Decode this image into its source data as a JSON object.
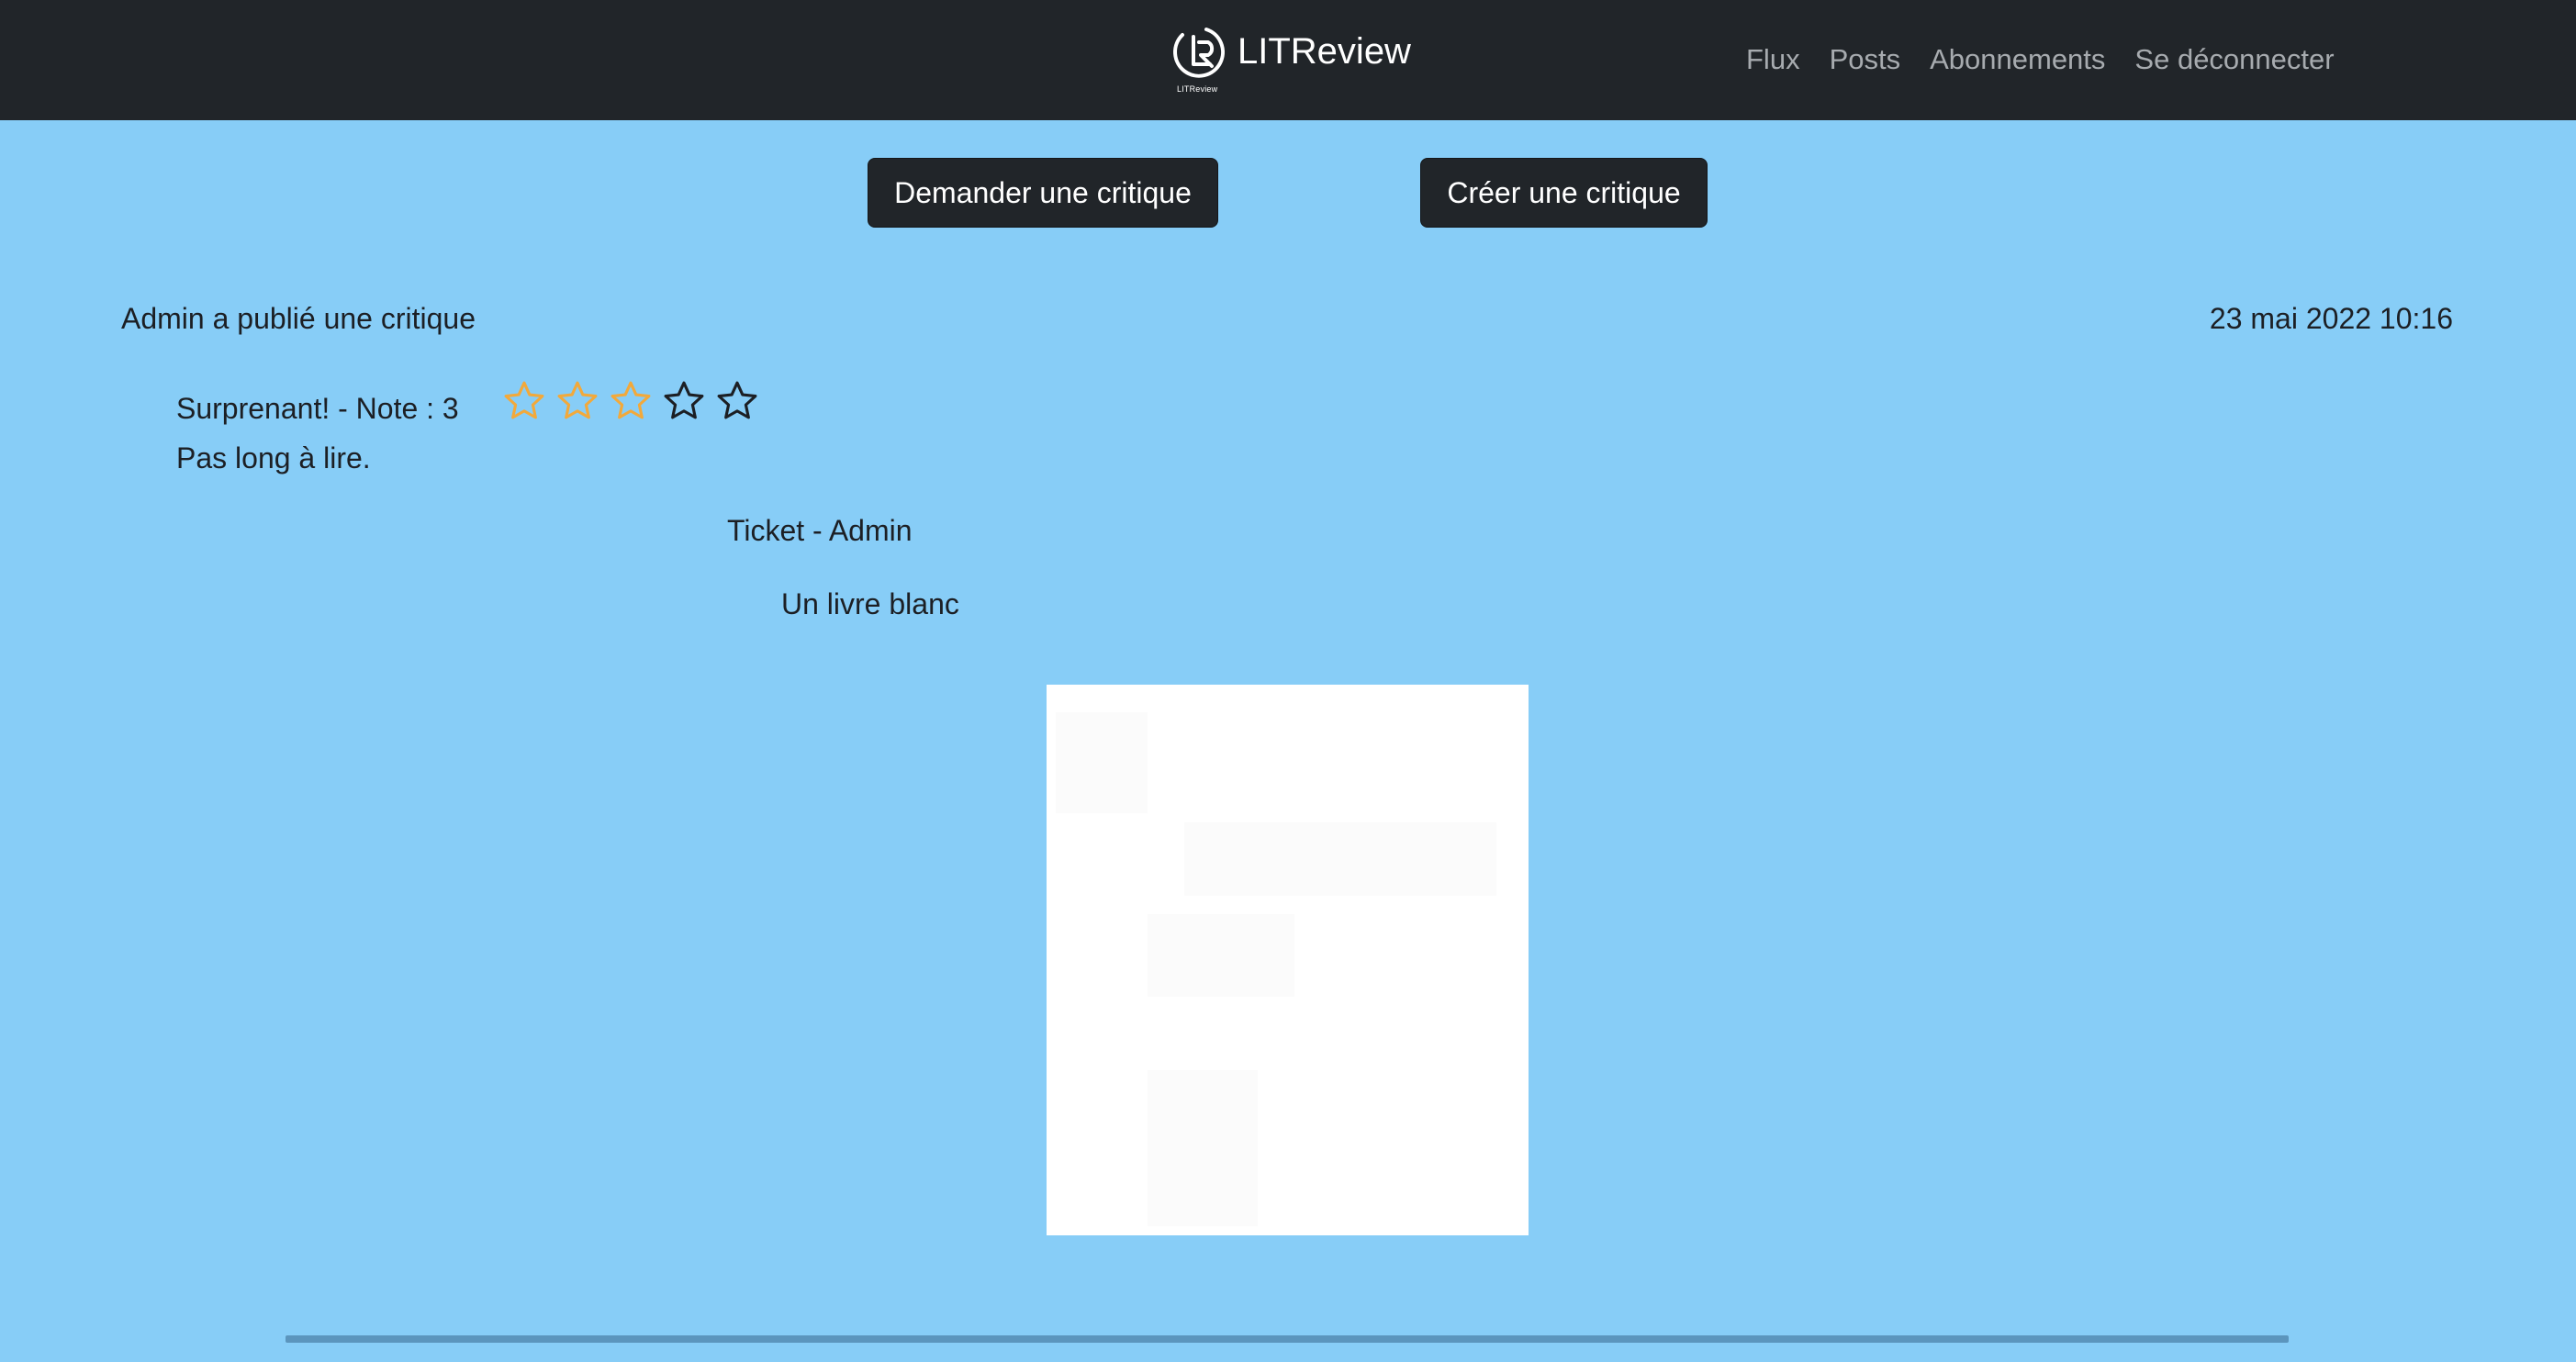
{
  "app": {
    "brand_name": "LITReview",
    "logo_caption": "LITReview"
  },
  "nav": {
    "items": [
      {
        "label": "Flux"
      },
      {
        "label": "Posts"
      },
      {
        "label": "Abonnements"
      },
      {
        "label": "Se déconnecter"
      }
    ]
  },
  "actions": {
    "request_review_label": "Demander une critique",
    "create_review_label": "Créer une critique"
  },
  "post": {
    "author_line": "Admin a publié une critique",
    "date": "23 mai 2022 10:16",
    "headline": "Surprenant! - Note : 3",
    "rating": 3,
    "rating_max": 5,
    "body": "Pas long à lire.",
    "ticket": {
      "title": "Ticket - Admin",
      "book_title": "Un livre blanc"
    }
  },
  "colors": {
    "page_background": "#87cdf7",
    "navbar_background": "#212529",
    "star_filled": "#f2a93b",
    "star_empty": "#1c1f24"
  }
}
